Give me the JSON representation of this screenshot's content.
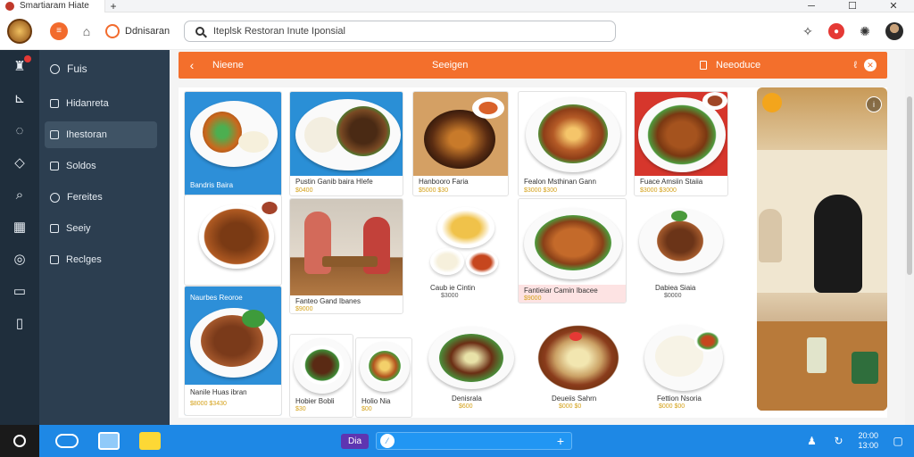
{
  "browser": {
    "tab_title": "Smartiaram Hiate",
    "new_tab": "+",
    "minimize": "─",
    "maximize": "☐",
    "close": "✕"
  },
  "topbar": {
    "app_button": "≡",
    "workspace_label": "Ddnisaran",
    "search_placeholder": "Iteplsk Restoran Inute Iponsial"
  },
  "sidebar": {
    "header": "Fuis",
    "items": [
      {
        "label": "Hidanreta",
        "active": false
      },
      {
        "label": "Ihestoran",
        "active": true
      },
      {
        "label": "Soldos",
        "active": false
      },
      {
        "label": "Fereites",
        "active": false
      },
      {
        "label": "Seeiy",
        "active": false
      },
      {
        "label": "Reclges",
        "active": false
      }
    ]
  },
  "orange_bar": {
    "back": "‹",
    "left_label": "Nieene",
    "center_label": "Seeigen",
    "right_label": "Neeoduce"
  },
  "cards": [
    {
      "name": "Bandris Baira",
      "price": ""
    },
    {
      "name": "Pustin Ganib baira Hlefe",
      "price": "$0400"
    },
    {
      "name": "Hanbooro Faria",
      "price": "$5000 $30"
    },
    {
      "name": "Fealon Msthinan Gann",
      "price": "$3000 $300"
    },
    {
      "name": "Fuace Amsiin Staiia",
      "price": "$3000 $3000"
    },
    {
      "name": "Fanteo Gand Ibanes",
      "price": "$9000"
    },
    {
      "name": "Caub ie Cintin",
      "price": "$3000"
    },
    {
      "name": "Fantieiar Camin Ibacee",
      "price": "$9000"
    },
    {
      "name": "Dabiea Siaia",
      "price": "$0000"
    },
    {
      "name": "Naurbes Reoroe",
      "price": ""
    },
    {
      "name": "Nanile Huas ibran",
      "price": "$8000 $3430"
    },
    {
      "name": "Hobier Bobli",
      "price": "$30"
    },
    {
      "name": "Holio Nia",
      "price": "$00"
    },
    {
      "name": "Denisrala",
      "price": "$600"
    },
    {
      "name": "Deueiis Sahrn",
      "price": "$000 $0"
    },
    {
      "name": "Fettion Nsoria",
      "price": "$000 $00"
    }
  ],
  "side_panel": {
    "info": "i"
  },
  "taskbar": {
    "pill_label": "Dia",
    "clock_line1": "20:00",
    "clock_line2": "13:00"
  },
  "colors": {
    "accent_orange": "#f36f2c",
    "sidebar": "#2c3e50",
    "rail": "#1f2e3c",
    "taskbar": "#1e88e5",
    "price_gold": "#d4a017"
  }
}
